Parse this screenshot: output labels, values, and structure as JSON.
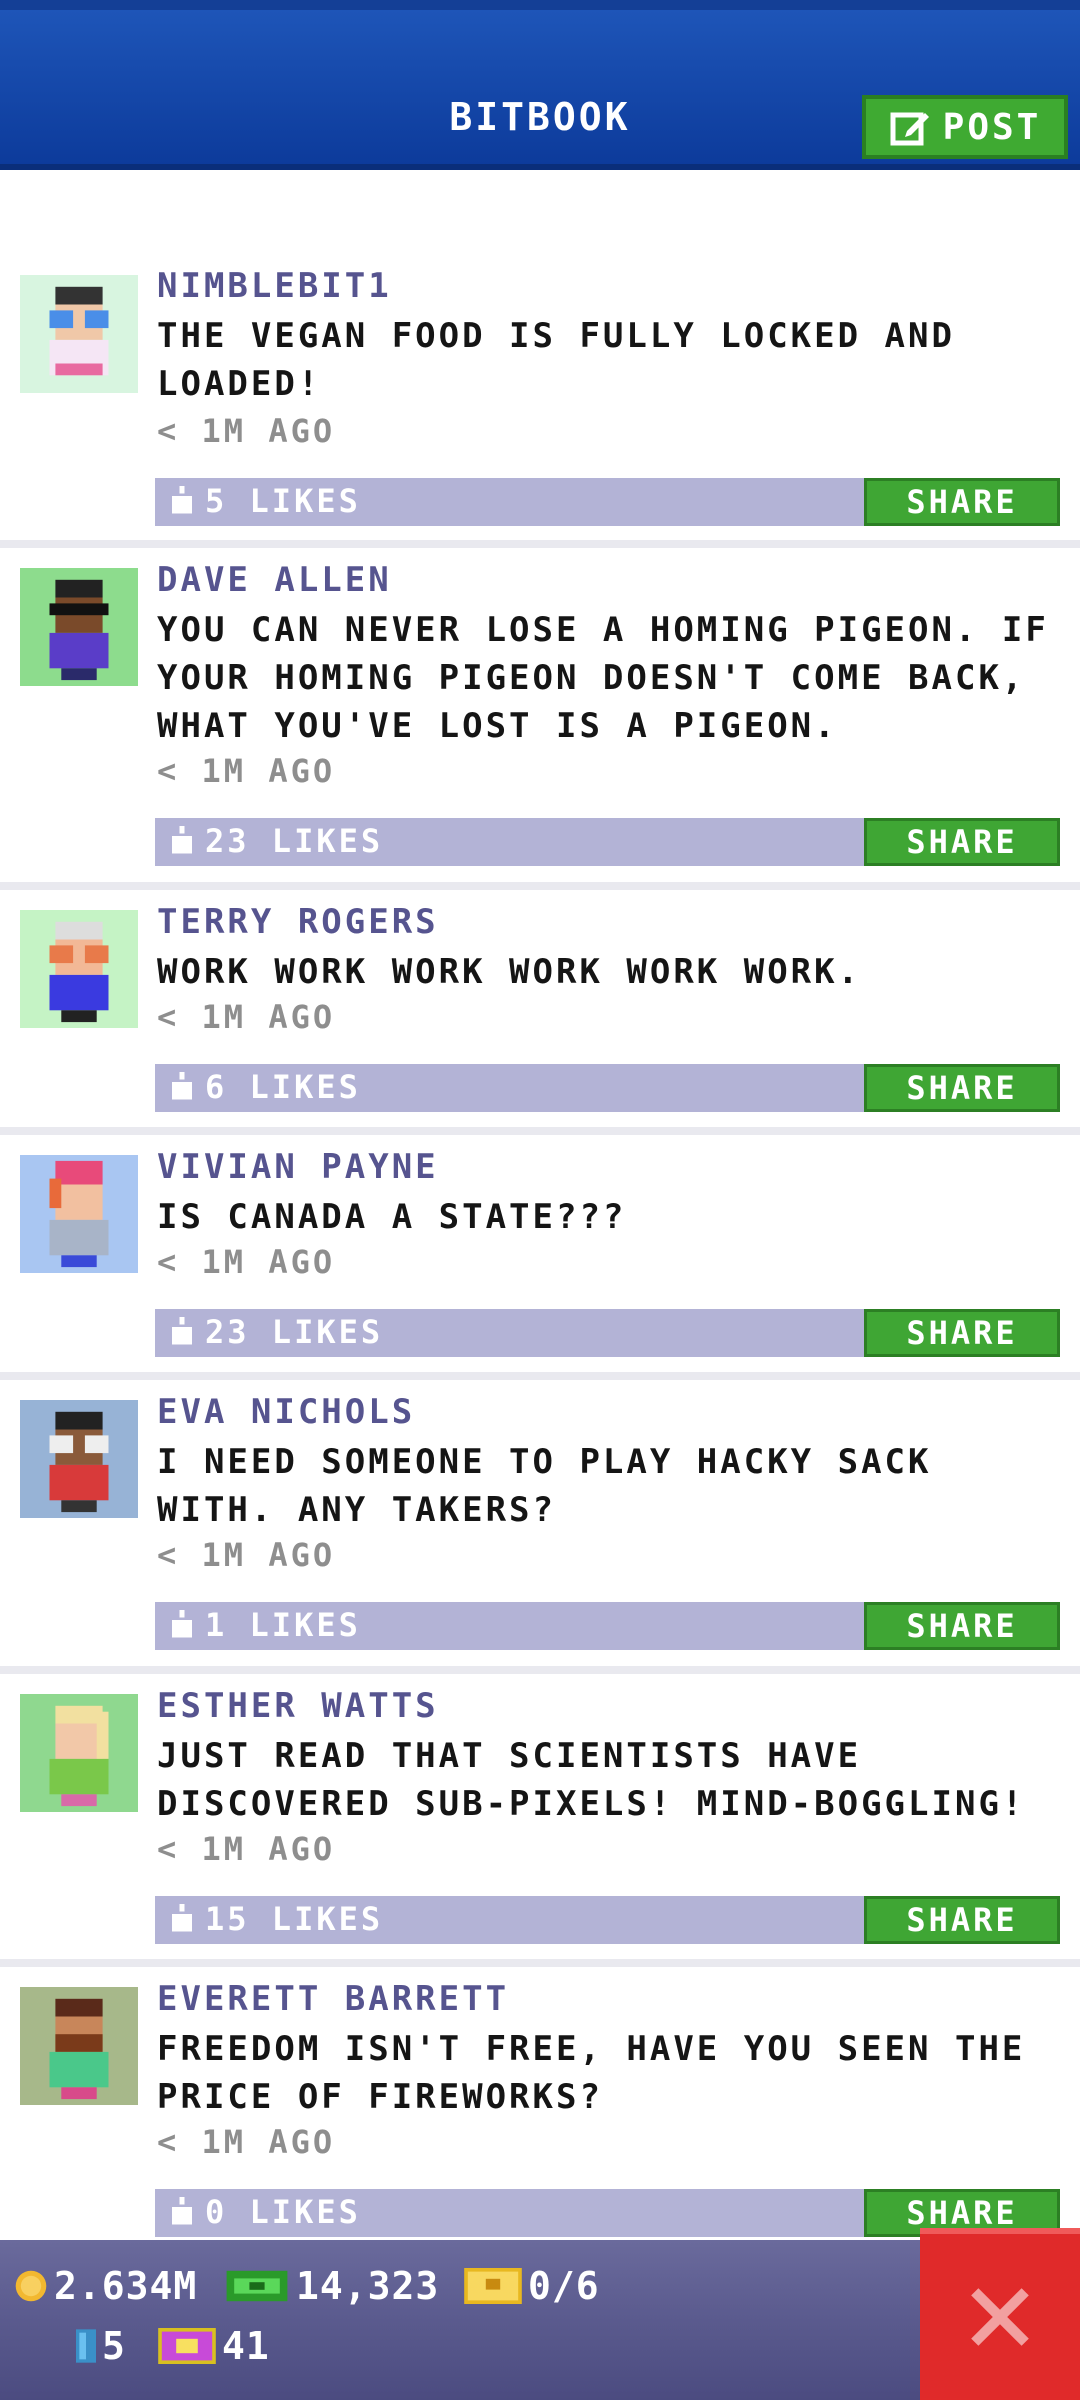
{
  "header": {
    "title": "BITBOOK",
    "post_label": "POST"
  },
  "posts": [
    {
      "author": "NIMBLEBIT1",
      "message": "THE VEGAN FOOD IS FULLY LOCKED AND LOADED!",
      "time": "< 1M AGO",
      "likes": "5 LIKES",
      "share": "SHARE",
      "avatar_bg": "#d8f5e0"
    },
    {
      "author": "DAVE ALLEN",
      "message": "YOU CAN NEVER LOSE A HOMING PIGEON. IF YOUR HOMING PIGEON DOESN'T COME BACK, WHAT YOU'VE LOST IS A PIGEON.",
      "time": "< 1M AGO",
      "likes": "23 LIKES",
      "share": "SHARE",
      "avatar_bg": "#8ddc8d"
    },
    {
      "author": "TERRY ROGERS",
      "message": "WORK WORK WORK WORK WORK WORK.",
      "time": "< 1M AGO",
      "likes": "6 LIKES",
      "share": "SHARE",
      "avatar_bg": "#c5f3c5"
    },
    {
      "author": "VIVIAN PAYNE",
      "message": "IS CANADA A STATE???",
      "time": "< 1M AGO",
      "likes": "23 LIKES",
      "share": "SHARE",
      "avatar_bg": "#a9c6f2"
    },
    {
      "author": "EVA NICHOLS",
      "message": "I NEED SOMEONE TO PLAY HACKY SACK WITH. ANY TAKERS?",
      "time": "< 1M AGO",
      "likes": "1 LIKES",
      "share": "SHARE",
      "avatar_bg": "#97b3d6"
    },
    {
      "author": "ESTHER WATTS",
      "message": "JUST READ THAT SCIENTISTS HAVE DISCOVERED SUB-PIXELS! MIND-BOGGLING!",
      "time": "< 1M AGO",
      "likes": "15 LIKES",
      "share": "SHARE",
      "avatar_bg": "#8fd88f"
    },
    {
      "author": "EVERETT BARRETT",
      "message": "FREEDOM ISN'T FREE, HAVE YOU SEEN THE PRICE OF FIREWORKS?",
      "time": "< 1M AGO",
      "likes": "0 LIKES",
      "share": "SHARE",
      "avatar_bg": "#a7b88a"
    }
  ],
  "footer": {
    "coins": "2.634M",
    "bux": "14,323",
    "tickets": "0/6",
    "keys": "5",
    "golden": "41"
  },
  "icons": {
    "post": "edit-icon",
    "like": "thumb-icon",
    "coin": "coin-icon",
    "bux": "bux-icon",
    "ticket": "ticket-icon",
    "key": "key-icon",
    "golden": "golden-ticket-icon",
    "close": "close-icon"
  },
  "colors": {
    "header": "#1a4fb0",
    "author": "#56548f",
    "likebar": "#b3b3d6",
    "share": "#3fa634",
    "close": "#e02a2a"
  }
}
